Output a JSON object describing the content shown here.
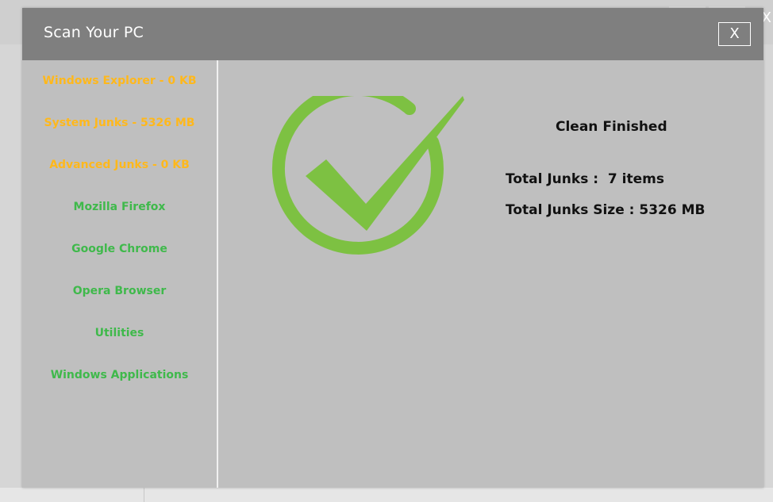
{
  "dialog": {
    "title": "Scan Your PC",
    "close_label": "X"
  },
  "sidebar": {
    "items": [
      {
        "label": "Windows Explorer - 0 KB",
        "color": "#ffb81c"
      },
      {
        "label": "System Junks - 5326 MB",
        "color": "#ffb81c"
      },
      {
        "label": "Advanced Junks - 0 KB",
        "color": "#ffb81c"
      },
      {
        "label": "Mozilla Firefox",
        "color": "#3fb94b"
      },
      {
        "label": "Google Chrome",
        "color": "#3fb94b"
      },
      {
        "label": "Opera Browser",
        "color": "#3fb94b"
      },
      {
        "label": "Utilities",
        "color": "#3fb94b"
      },
      {
        "label": "Windows Applications",
        "color": "#3fb94b"
      }
    ]
  },
  "main": {
    "status_icon": "check-circle-icon",
    "status_color": "#7dc142",
    "status_title": "Clean Finished",
    "total_junks_label": "Total Junks :",
    "total_junks_value": "7 items",
    "total_size_label": "Total Junks Size :",
    "total_size_value": "5326 MB"
  },
  "background": {
    "close_glyph": "X"
  }
}
